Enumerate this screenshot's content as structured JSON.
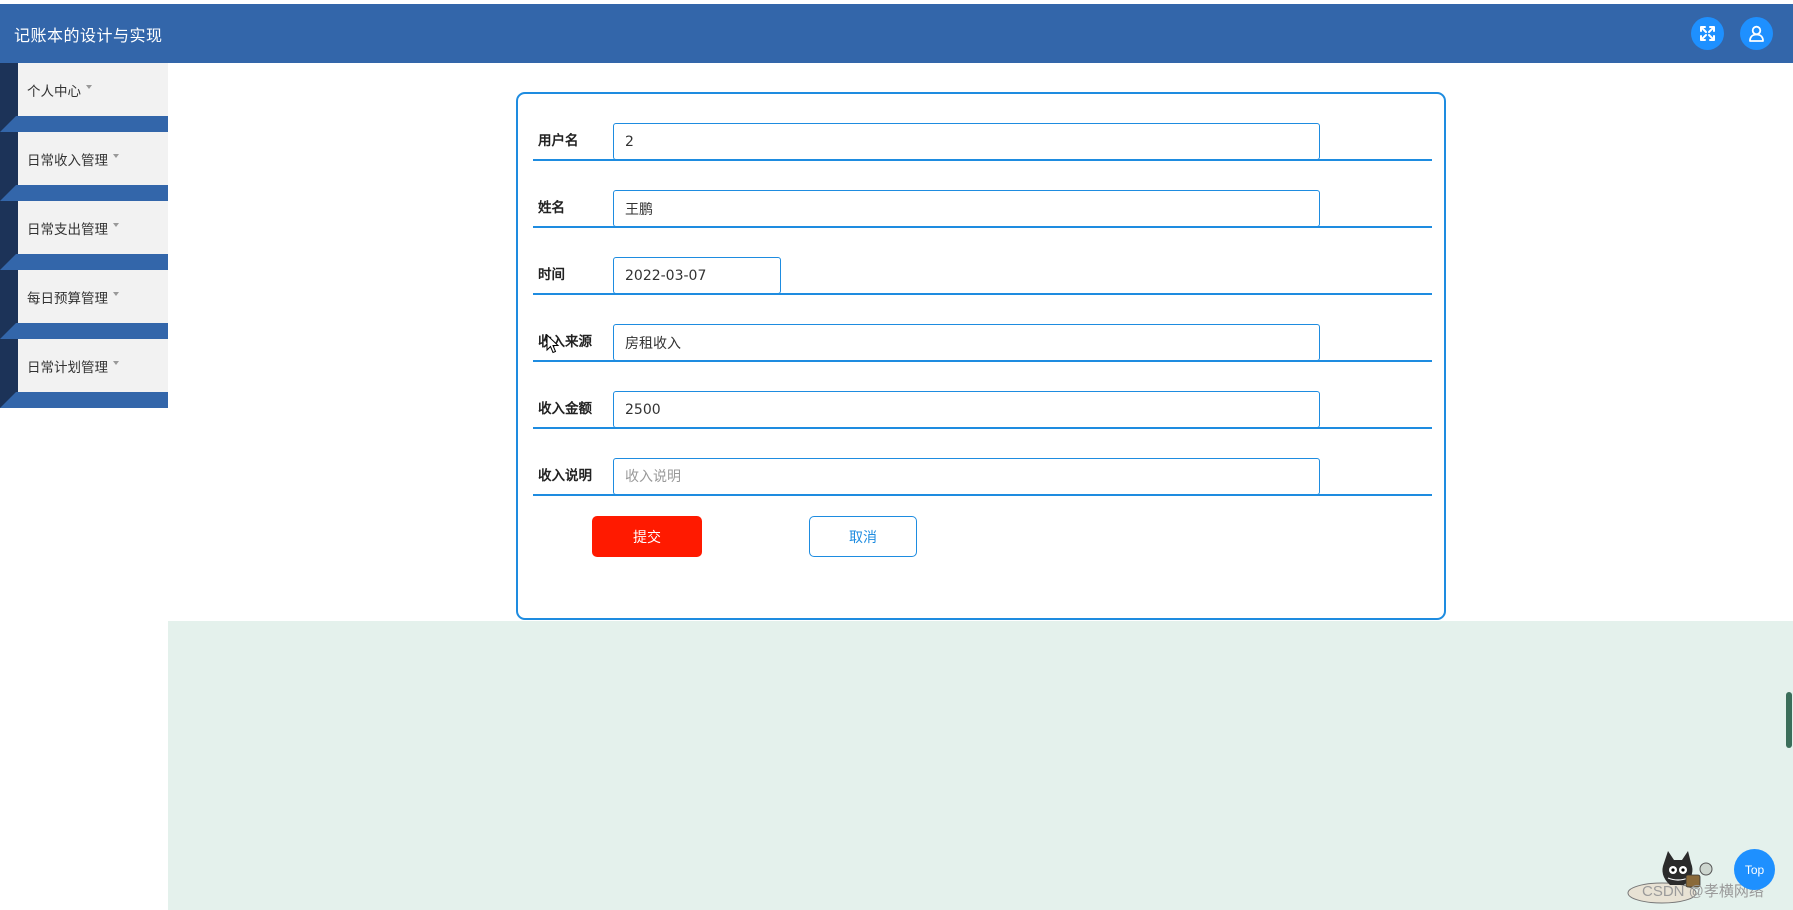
{
  "app": {
    "title": "记账本的设计与实现"
  },
  "header": {
    "icons": [
      "fullscreen-icon",
      "user-icon"
    ]
  },
  "sidebar": {
    "items": [
      {
        "label": "个人中心"
      },
      {
        "label": "日常收入管理"
      },
      {
        "label": "日常支出管理"
      },
      {
        "label": "每日预算管理"
      },
      {
        "label": "日常计划管理"
      }
    ]
  },
  "form": {
    "fields": [
      {
        "label": "用户名",
        "value": "2",
        "placeholder": ""
      },
      {
        "label": "姓名",
        "value": "王鹏",
        "placeholder": ""
      },
      {
        "label": "时间",
        "value": "2022-03-07",
        "placeholder": ""
      },
      {
        "label": "收入来源",
        "value": "房租收入",
        "placeholder": ""
      },
      {
        "label": "收入金额",
        "value": "2500",
        "placeholder": ""
      },
      {
        "label": "收入说明",
        "value": "",
        "placeholder": "收入说明"
      }
    ],
    "submit_label": "提交",
    "cancel_label": "取消"
  },
  "footer": {
    "top_label": "Top",
    "watermark": "CSDN @孝横网络"
  },
  "colors": {
    "header_bg": "#3366aa",
    "accent": "#1e8ce0",
    "submit_bg": "#ff1a00",
    "lower_bg": "#e4f1ec"
  }
}
